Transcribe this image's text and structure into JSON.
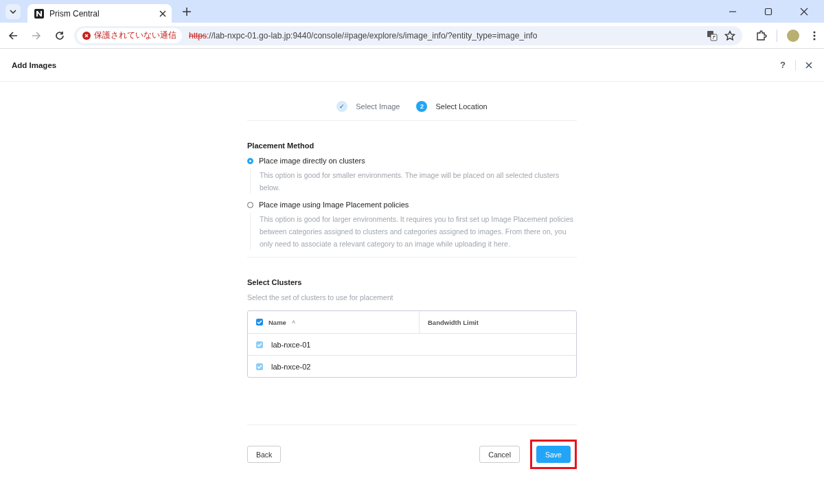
{
  "browser": {
    "tab_title": "Prism Central",
    "security_label": "保護されていない通信",
    "url_scheme": "https",
    "url_rest": "://lab-nxpc-01.go-lab.jp:9440/console/#page/explore/s/image_info/?entity_type=image_info"
  },
  "dialog": {
    "title": "Add Images",
    "help": "?"
  },
  "steps": [
    {
      "number": "✓",
      "label": "Select Image",
      "kind": "done"
    },
    {
      "number": "2",
      "label": "Select Location",
      "kind": "current"
    }
  ],
  "placement": {
    "heading": "Placement Method",
    "options": [
      {
        "label": "Place image directly on clusters",
        "selected": true,
        "description": "This option is good for smaller environments. The image will be placed on all selected clusters below."
      },
      {
        "label": "Place image using Image Placement policies",
        "selected": false,
        "description": "This option is good for larger environments. It requires you to first set up Image Placement policies between categories assigned to clusters and categories assigned to images. From there on, you only need to associate a relevant category to an image while uploading it here."
      }
    ]
  },
  "clusters": {
    "heading": "Select Clusters",
    "hint": "Select the set of clusters to use for placement",
    "all_checked": true,
    "columns": [
      "Name",
      "Bandwidth Limit"
    ],
    "sort_mark": "˄",
    "rows": [
      {
        "name": "lab-nxce-01",
        "checked": true
      },
      {
        "name": "lab-nxce-02",
        "checked": true
      }
    ]
  },
  "buttons": {
    "back": "Back",
    "cancel": "Cancel",
    "save": "Save",
    "save_highlighted": true
  }
}
